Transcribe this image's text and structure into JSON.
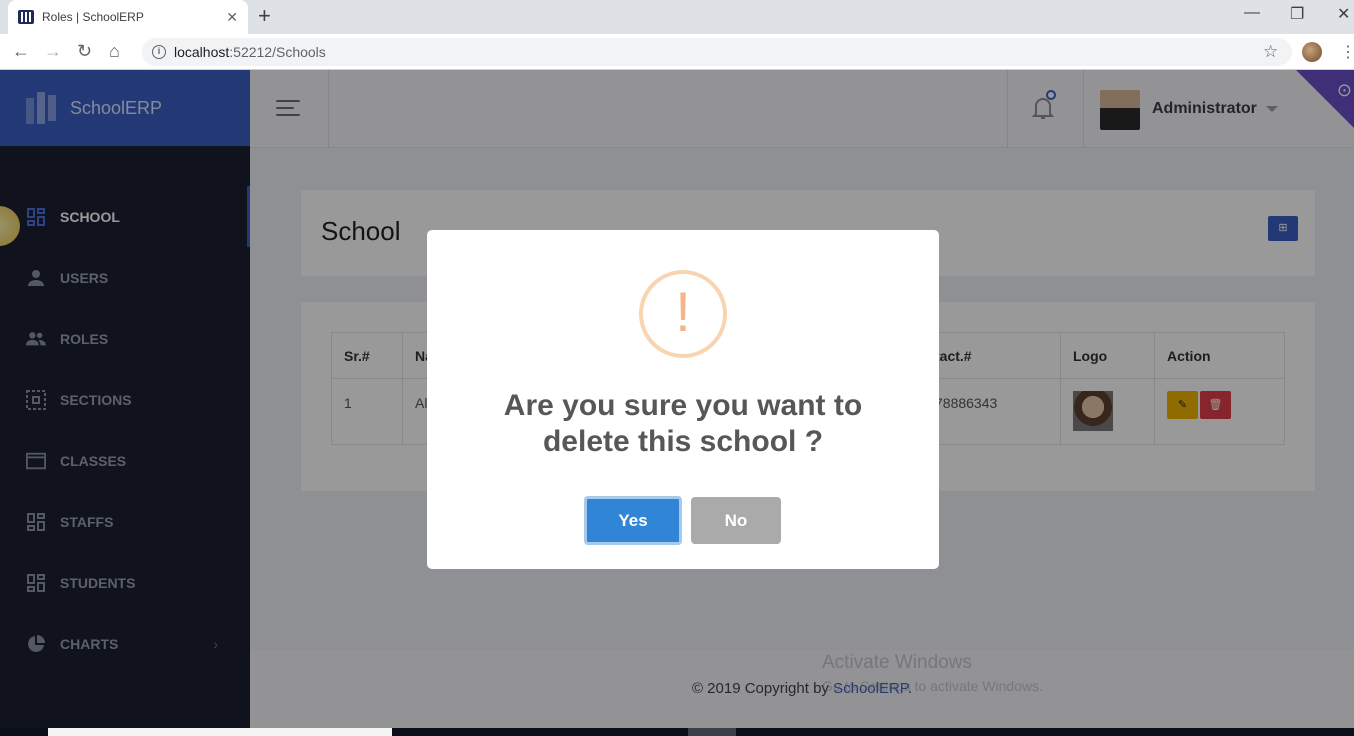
{
  "browser": {
    "tab_title": "Roles | SchoolERP",
    "tab_close": "✕",
    "new_tab": "+",
    "url_host": "localhost",
    "url_path": ":52212/Schools",
    "minimize": "—",
    "maximize": "❐",
    "close": "✕"
  },
  "app": {
    "brand": "SchoolERP",
    "admin_name": "Administrator"
  },
  "sidebar": {
    "items": [
      {
        "label": "SCHOOL",
        "icon": "dashboard-icon",
        "active": true
      },
      {
        "label": "USERS",
        "icon": "user-icon"
      },
      {
        "label": "ROLES",
        "icon": "group-icon"
      },
      {
        "label": "SECTIONS",
        "icon": "selection-icon"
      },
      {
        "label": "CLASSES",
        "icon": "window-icon"
      },
      {
        "label": "STAFFS",
        "icon": "dashboard-icon"
      },
      {
        "label": "STUDENTS",
        "icon": "dashboard-icon"
      },
      {
        "label": "CHARTS",
        "icon": "pie-chart-icon",
        "has_submenu": true
      }
    ]
  },
  "page": {
    "title": "School"
  },
  "table": {
    "headers": [
      "Sr.#",
      "Na",
      "",
      "tact.#",
      "Logo",
      "Action"
    ],
    "rows": [
      {
        "sr": "1",
        "name": "Al",
        "contact": "78886343"
      }
    ]
  },
  "footer": {
    "prefix": "© 2019 Copyright by ",
    "brand": "SchoolERP",
    "suffix": "."
  },
  "watermark": {
    "line1": "Activate Windows",
    "line2": "Go to Settings to activate Windows."
  },
  "dialog": {
    "icon": "!",
    "title": "Are you sure you want to delete this school ?",
    "yes_label": "Yes",
    "no_label": "No"
  },
  "colors": {
    "brand": "#3b5fc4",
    "sidebar": "#1b2133",
    "confirm": "#3085d6",
    "cancel": "#aaaaaa",
    "warning": "#f8bb86"
  }
}
